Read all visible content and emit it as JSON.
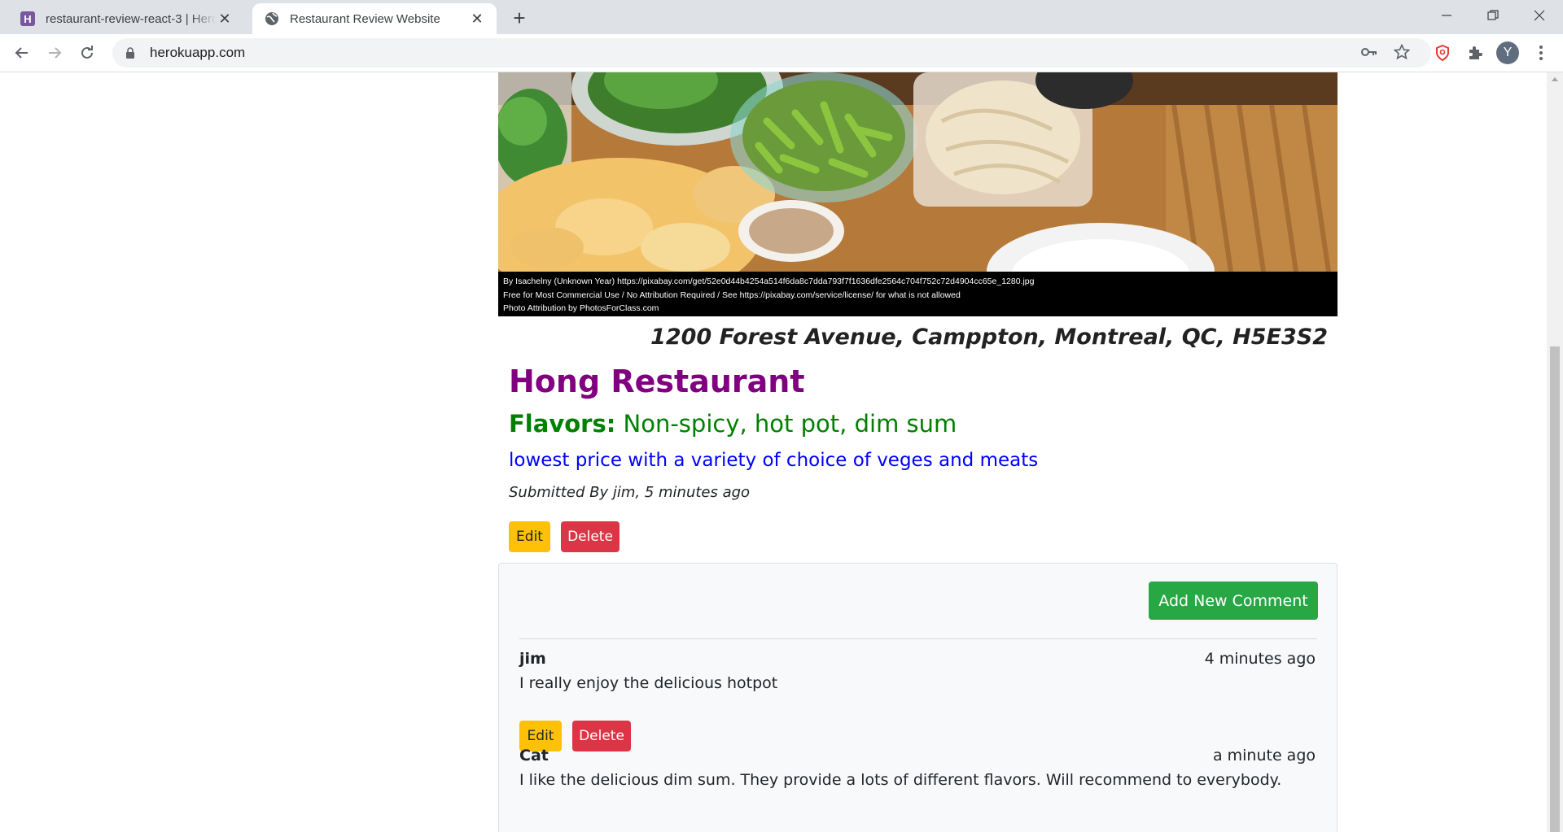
{
  "browser": {
    "tabs": [
      {
        "title": "restaurant-review-react-3 | Heroku",
        "active": false
      },
      {
        "title": "Restaurant Review Website",
        "active": true
      }
    ],
    "url": "herokuapp.com",
    "profile_initial": "Y"
  },
  "photo": {
    "caption_lines": [
      "By Isachelny (Unknown Year) https://pixabay.com/get/52e0d44b4254a514f6da8c7dda793f7f1636dfe2564c704f752c72d4904cc65e_1280.jpg",
      "Free for Most Commercial Use / No Attribution Required / See https://pixabay.com/service/license/ for what is not allowed",
      "Photo Attribution by PhotosForClass.com"
    ]
  },
  "restaurant": {
    "address": "1200 Forest Avenue, Camppton, Montreal, QC, H5E3S2",
    "name": "Hong Restaurant",
    "flavors_label": "Flavors:",
    "flavors": "Non-spicy, hot pot, dim sum",
    "description": "lowest price with a variety of choice of veges and meats",
    "submitted": "Submitted By jim, 5 minutes ago",
    "edit_label": "Edit",
    "delete_label": "Delete"
  },
  "comments": {
    "add_label": "Add New Comment",
    "items": [
      {
        "author": "jim",
        "time": "4 minutes ago",
        "text": "I really enjoy the delicious hotpot",
        "edit_label": "Edit",
        "delete_label": "Delete"
      },
      {
        "author": "Cat",
        "time": "a minute ago",
        "text": "I like the delicious dim sum. They provide a lots of different flavors. Will recommend to everybody."
      }
    ]
  },
  "colors": {
    "name": "#800080",
    "flavors": "#008000",
    "description": "#0000ff",
    "warning": "#ffc107",
    "danger": "#dc3545",
    "success": "#28a745"
  }
}
